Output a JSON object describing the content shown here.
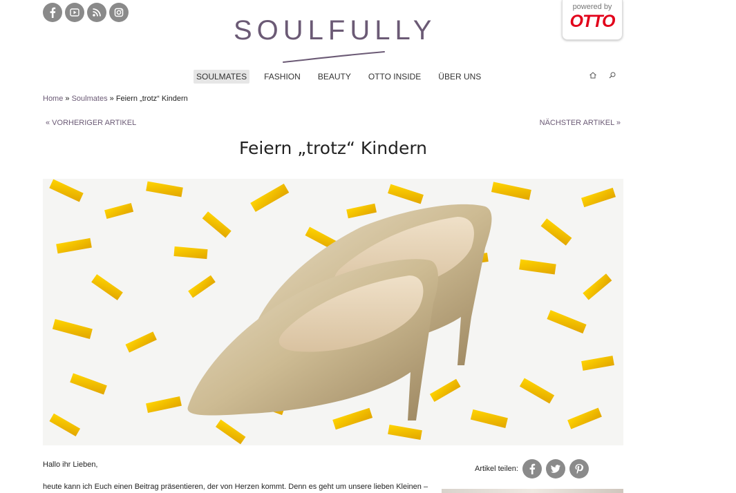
{
  "social_top": [
    {
      "icon": "facebook-icon",
      "glyph": "f"
    },
    {
      "icon": "youtube-icon",
      "glyph": "You Tube"
    },
    {
      "icon": "rss-icon",
      "glyph": "rss"
    },
    {
      "icon": "instagram-icon",
      "glyph": "ig"
    }
  ],
  "logo": {
    "text": "SOULFULLY"
  },
  "otto_badge": {
    "powered": "powered by",
    "brand": "OTTO"
  },
  "nav": {
    "items": [
      "SOULMATES",
      "FASHION",
      "BEAUTY",
      "OTTO INSIDE",
      "ÜBER UNS"
    ],
    "active_index": 0
  },
  "breadcrumb": {
    "home": "Home",
    "sep": "»",
    "section": "Soulmates",
    "current": "Feiern „trotz“ Kindern"
  },
  "pager": {
    "prev": "« VORHERIGER ARTIKEL",
    "next": "NÄCHSTER ARTIKEL »"
  },
  "article": {
    "title": "Feiern „trotz“ Kindern",
    "greeting": "Hallo ihr Lieben,",
    "paragraph1": "heute kann ich Euch einen Beitrag präsentieren, der von Herzen kommt. Denn es geht um unsere lieben Kleinen –"
  },
  "share": {
    "label": "Artikel teilen:"
  },
  "colors": {
    "brand": "#6b5a75",
    "icon_gray": "#8a8a8a",
    "otto_red": "#e2001a",
    "confetti": "#f2c200"
  }
}
